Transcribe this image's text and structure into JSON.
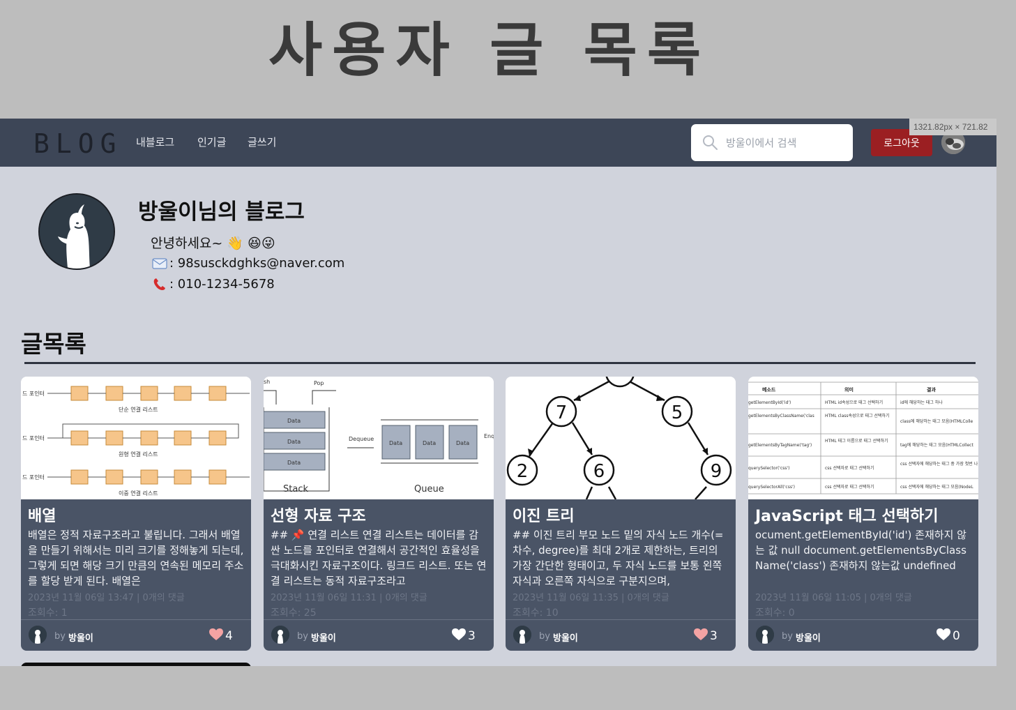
{
  "outer_title": "사용자 글 목록",
  "dimension_badge": "1321.82px × 721.82",
  "navbar": {
    "logo": "BLOG",
    "links": [
      "내블로그",
      "인기글",
      "글쓰기"
    ],
    "search_placeholder": "방울이에서 검색",
    "logout_label": "로그아웃"
  },
  "profile": {
    "blog_name": "방울이님의 블로그",
    "greeting": "안녕하세요~ 👋 😆😜",
    "email": ": 98susckdghks@naver.com",
    "phone": ": 010-1234-5678"
  },
  "section_title": "글목록",
  "posts": [
    {
      "title": "배열",
      "excerpt": "배열은 정적 자료구조라고 불립니다. 그래서 배열을 만들기 위해서는 미리 크기를 정해놓게 되는데, 그렇게 되면 해당 크기 만큼의 연속된 메모리 주소를 할당 받게 된다. 배열은",
      "meta": "2023년 11월 06일 13:47 | 0개의 댓글",
      "views": "조회수: 1",
      "by": "by",
      "author": "방울이",
      "likes": "4",
      "liked": true,
      "thumb_labels": [
        "드 포인터",
        "단순 연결 리스트",
        "드 포인터",
        "원형 연결 리스트",
        "드 포인터",
        "이중 연결 리스트"
      ]
    },
    {
      "title": "선형 자료 구조",
      "excerpt": "## 📌 연결 리스트 연결 리스트는 데이터를 감싼 노드를 포인터로 연결해서 공간적인 효율성을 극대화시킨 자료구조이다. 링크드 리스트. 또는 연결 리스트는 동적 자료구조라고",
      "meta": "2023년 11월 06일 11:31 | 0개의 댓글",
      "views": "조회수: 25",
      "by": "by",
      "author": "방울이",
      "likes": "3",
      "liked": false,
      "thumb_labels": [
        "sh",
        "Pop",
        "Data",
        "Data",
        "Data",
        "Dequeue",
        "Data",
        "Data",
        "Data",
        "Enq",
        "Stack",
        "Queue"
      ]
    },
    {
      "title": "이진 트리",
      "excerpt": "## 이진 트리 부모 노드 밑의 자식 노드 개수(=차수, degree)를 최대 2개로 제한하는, 트리의 가장 간단한 형태이고, 두 자식 노드를 보통 왼쪽 자식과 오른쪽 자식으로 구분지으며,",
      "meta": "2023년 11월 06일 11:35 | 0개의 댓글",
      "views": "조회수: 10",
      "by": "by",
      "author": "방울이",
      "likes": "3",
      "liked": true,
      "thumb_labels": [
        "7",
        "5",
        "2",
        "6",
        "9"
      ]
    },
    {
      "title": "JavaScript 태그 선택하기",
      "excerpt": "ocument.getElementById('id') 존재하지 않는 값 null document.getElementsByClassName('class') 존재하지 않는값 undefined",
      "meta": "2023년 11월 06일 11:05 | 0개의 댓글",
      "views": "조회수: 0",
      "by": "by",
      "author": "방울이",
      "likes": "0",
      "liked": false,
      "thumb_table": {
        "headers": [
          "메소드",
          "의미",
          "결과"
        ],
        "rows": [
          [
            "getElementById('id')",
            "HTML id속성으로 태그 선택하기",
            "id에 해당하는 태그 하나"
          ],
          [
            "getElementsByClassName('clas",
            "HTML class속성으로 태그 선택하기",
            "class에 해당하는 태그 모음(HTMLColle"
          ],
          [
            "getElementsByTagName('tag')",
            "HTML 태그 이름으로 태그 선택하기",
            "tag에 해당하는 태그 모음(HTMLCollect"
          ],
          [
            "querySelector('css')",
            "css 선택자로 태그 선택하기",
            "css 선택자에 해당하는 태그 중 가장 첫번 나"
          ],
          [
            "querySelectorAll('css')",
            "css 선택자로 태그 선택하기",
            "css 선택자에 해당하는 태그 모음(NodeL"
          ]
        ]
      }
    }
  ],
  "colors": {
    "navbar": "#3d4657",
    "page_bg": "#d0d3dc",
    "card_bg": "#4a5466",
    "logout": "#9b1f22",
    "heart_liked": "#f4a3a3",
    "heart_default": "#ffffff"
  }
}
